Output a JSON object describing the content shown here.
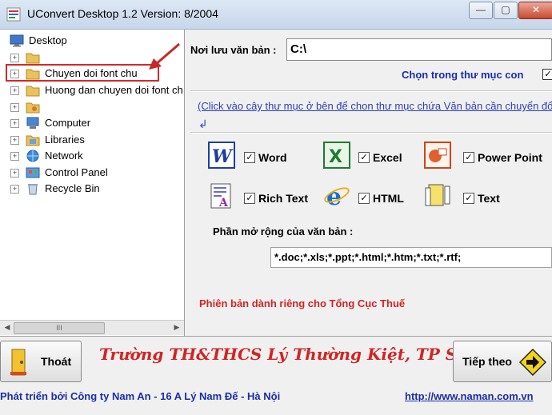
{
  "window": {
    "title": "UConvert Desktop 1.2    Version: 8/2004",
    "minimize": "—",
    "maximize": "▢",
    "close": "✕"
  },
  "tree": {
    "items": [
      {
        "label": "Desktop",
        "icon": "desktop-icon",
        "expander": ""
      },
      {
        "label": "",
        "icon": "folder-icon",
        "expander": "+"
      },
      {
        "label": "Chuyen doi font chu",
        "icon": "folder-icon",
        "expander": "+"
      },
      {
        "label": "Huong dan chuyen doi font ch",
        "icon": "folder-icon",
        "expander": "+"
      },
      {
        "label": "",
        "icon": "user-folder-icon",
        "expander": "+"
      },
      {
        "label": "Computer",
        "icon": "computer-icon",
        "expander": "+"
      },
      {
        "label": "Libraries",
        "icon": "libraries-icon",
        "expander": "+"
      },
      {
        "label": "Network",
        "icon": "network-icon",
        "expander": "+"
      },
      {
        "label": "Control Panel",
        "icon": "control-panel-icon",
        "expander": "+"
      },
      {
        "label": "Recycle Bin",
        "icon": "recycle-bin-icon",
        "expander": "+"
      }
    ],
    "scroll_grip": "III"
  },
  "form": {
    "save_label": "Nơi lưu văn bản :",
    "save_path": "C:\\",
    "subfolder_label": "Chọn trong thư mục con",
    "subfolder_checked": "✓",
    "hint": "(Click vào cây thư mục ở bên để chon thư mục chứa Văn bản cần chuyển đổi)",
    "hint_icon": "↲"
  },
  "file_types": [
    {
      "label": "Word",
      "icon": "word-icon",
      "checked": "✓"
    },
    {
      "label": "Excel",
      "icon": "excel-icon",
      "checked": "✓"
    },
    {
      "label": "Power Point",
      "icon": "powerpoint-icon",
      "checked": "✓"
    },
    {
      "label": "Rich Text",
      "icon": "richtext-icon",
      "checked": "✓"
    },
    {
      "label": "HTML",
      "icon": "ie-icon",
      "checked": "✓"
    },
    {
      "label": "Text",
      "icon": "text-icon",
      "checked": "✓"
    }
  ],
  "extensions": {
    "label": "Phần mở rộng của văn bản :",
    "value": "*.doc;*.xls;*.ppt;*.html;*.htm;*.txt;*.rtf;"
  },
  "edition_note": "Phiên bản dành riêng cho Tổng Cục Thuế",
  "bottom": {
    "exit_label": "Thoát",
    "school": "Trường TH&THCS Lý Thường Kiệt, TP Sóc Trăng",
    "next_label": "Tiếp theo",
    "developer": "Phát triển bởi Công ty Nam An - 16 A Lý Nam Đế - Hà Nội",
    "website": "http://www.naman.com.vn"
  },
  "colors": {
    "accent_red": "#d12424",
    "link_blue": "#1a2ea8"
  }
}
